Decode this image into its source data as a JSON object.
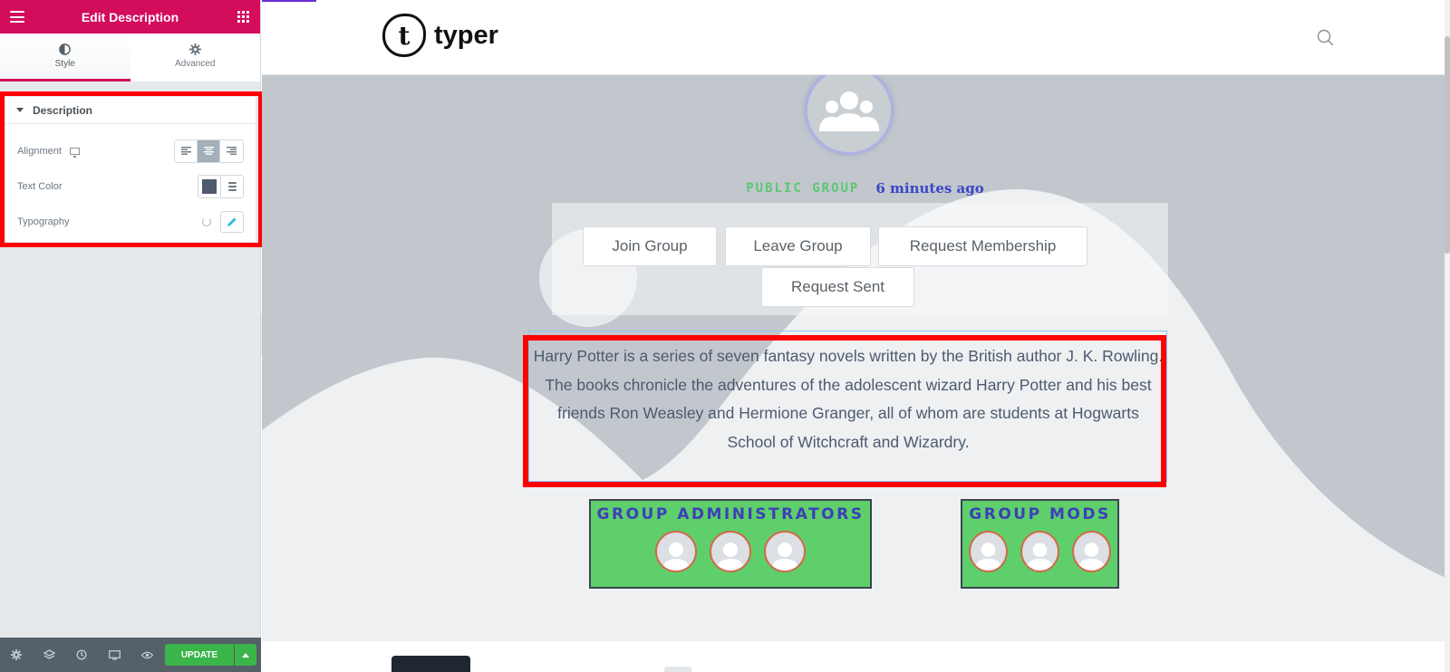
{
  "panel": {
    "title": "Edit Description",
    "tabs": [
      {
        "label": "Style",
        "icon": "contrast-icon"
      },
      {
        "label": "Advanced",
        "icon": "gear-icon"
      }
    ],
    "section": {
      "title": "Description",
      "controls": {
        "alignment_label": "Alignment",
        "alignment_selected": "center",
        "text_color_label": "Text Color",
        "text_color_value": "#4d5a6e",
        "typography_label": "Typography"
      }
    },
    "footer": {
      "icons": [
        "settings-icon",
        "layers-icon",
        "history-icon",
        "responsive-icon",
        "preview-eye-icon"
      ],
      "update_label": "UPDATE"
    }
  },
  "site": {
    "logo_letter": "t",
    "logo_text": "typer",
    "group": {
      "privacy": "PUBLIC GROUP",
      "time_ago": "6 minutes ago",
      "buttons": [
        "Join Group",
        "Leave Group",
        "Request Membership",
        "Request Sent"
      ],
      "description": "Harry Potter is a series of seven fantasy novels written by the British author J. K. Rowling. The books chronicle the adventures of the adolescent wizard Harry Potter and his best friends Ron Weasley and Hermione Granger, all of whom are students at Hogwarts School of Witchcraft and Wizardry.",
      "admins_title": "GROUP ADMINISTRATORS",
      "mods_title": "GROUP MODS"
    }
  },
  "colors": {
    "brand": "#d30c5c",
    "update_green": "#39b54a",
    "card_green": "#5ecf6b",
    "public_badge": "#5cc771",
    "time_ago": "#3c44c9",
    "highlight": "#ff0000"
  }
}
